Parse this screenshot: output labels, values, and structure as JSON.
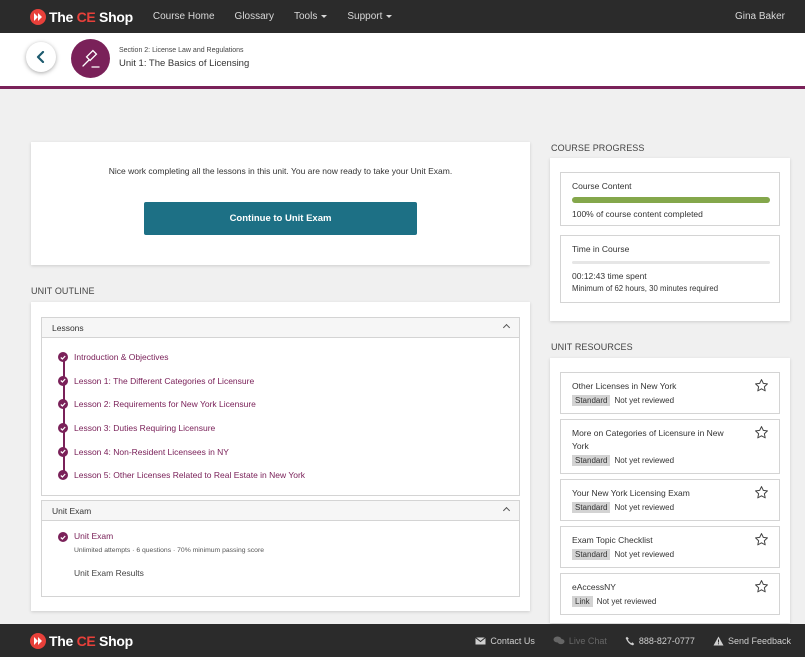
{
  "brand": {
    "the": "The ",
    "ce": "CE",
    "shop": " Shop"
  },
  "nav": {
    "items": [
      {
        "label": "Course Home",
        "dropdown": false
      },
      {
        "label": "Glossary",
        "dropdown": false
      },
      {
        "label": "Tools",
        "dropdown": true
      },
      {
        "label": "Support",
        "dropdown": true
      }
    ],
    "user": "Gina Baker"
  },
  "header": {
    "section": "Section 2: License Law and Regulations",
    "unit": "Unit 1: The Basics of Licensing",
    "badge_icon": "gavel-icon"
  },
  "completion": {
    "message": "Nice work completing all the lessons in this unit. You are now ready to take your Unit Exam.",
    "button": "Continue to Unit Exam"
  },
  "outline": {
    "title": "UNIT OUTLINE",
    "lessons_header": "Lessons",
    "lessons": [
      "Introduction & Objectives",
      "Lesson 1: The Different Categories of Licensure",
      "Lesson 2: Requirements for New York Licensure",
      "Lesson 3: Duties Requiring Licensure",
      "Lesson 4: Non-Resident Licensees in NY",
      "Lesson 5: Other Licenses Related to Real Estate in New York"
    ],
    "exam_header": "Unit Exam",
    "exam_name": "Unit Exam",
    "exam_details": "Unlimited attempts · 6 questions · 70% minimum passing score",
    "exam_results": "Unit Exam Results"
  },
  "progress": {
    "title": "COURSE PROGRESS",
    "content_label": "Course Content",
    "content_fraction": 1.0,
    "content_text": "100% of course content completed",
    "time_label": "Time in Course",
    "time_fraction": 0.0,
    "time_spent": "00:12:43 time spent",
    "time_required": "Minimum of 62 hours, 30 minutes required"
  },
  "resources": {
    "title": "UNIT RESOURCES",
    "items": [
      {
        "title": "Other Licenses in New York",
        "tag": "Standard",
        "status": "Not yet reviewed"
      },
      {
        "title": "More on Categories of Licensure in New York",
        "tag": "Standard",
        "status": "Not yet reviewed"
      },
      {
        "title": "Your New York Licensing Exam",
        "tag": "Standard",
        "status": "Not yet reviewed"
      },
      {
        "title": "Exam Topic Checklist",
        "tag": "Standard",
        "status": "Not yet reviewed"
      },
      {
        "title": "eAccessNY",
        "tag": "Link",
        "status": "Not yet reviewed"
      }
    ]
  },
  "footer": {
    "contact": "Contact Us",
    "chat": "Live Chat",
    "phone": "888-827-0777",
    "feedback": "Send Feedback"
  },
  "colors": {
    "brand_red": "#e8403a",
    "accent_purple": "#7a2159",
    "button_teal": "#1d7085",
    "progress_green": "#84a74b",
    "nav_dark": "#2b2b2b"
  }
}
